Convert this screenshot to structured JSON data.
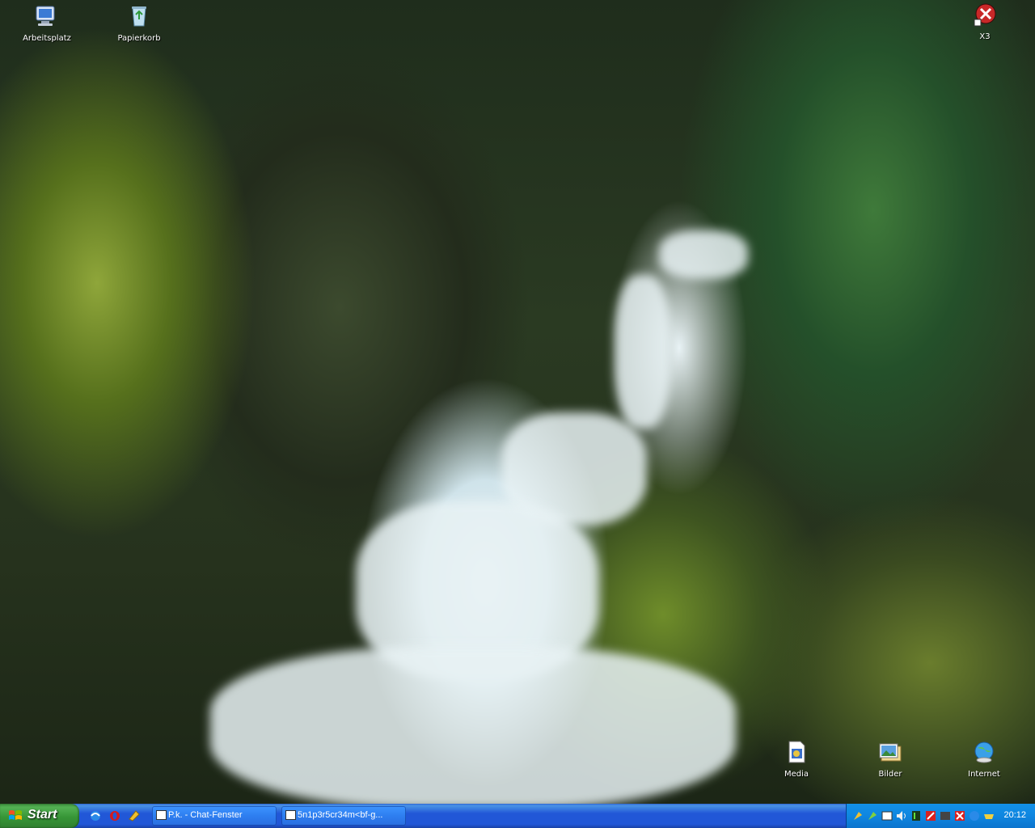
{
  "desktop": {
    "icons": [
      {
        "label": "Arbeitsplatz",
        "icon": "my-computer-icon"
      },
      {
        "label": "Papierkorb",
        "icon": "recycle-bin-icon"
      },
      {
        "label": "X3",
        "icon": "x3-icon"
      },
      {
        "label": "Media",
        "icon": "media-icon"
      },
      {
        "label": "Bilder",
        "icon": "pictures-icon"
      },
      {
        "label": "Internet",
        "icon": "internet-icon"
      }
    ]
  },
  "taskbar": {
    "start_label": "Start",
    "quick_launch": [
      "ie-icon",
      "opera-icon",
      "quicklaunch-extra-icon"
    ],
    "tasks": [
      {
        "label": "P.k. - Chat-Fenster"
      },
      {
        "label": "5n1p3r5cr34m<bf-g..."
      }
    ],
    "tray_icons": [
      "tray-icon-1",
      "tray-icon-2",
      "tray-icon-3",
      "volume-icon",
      "tray-icon-5",
      "tray-icon-6",
      "tray-icon-7",
      "tray-icon-8",
      "tray-icon-9",
      "tray-icon-10"
    ],
    "clock": "20:12"
  },
  "colors": {
    "taskbar_blue": "#2157d7",
    "start_green": "#379637",
    "tray_blue": "#0f86e0"
  }
}
